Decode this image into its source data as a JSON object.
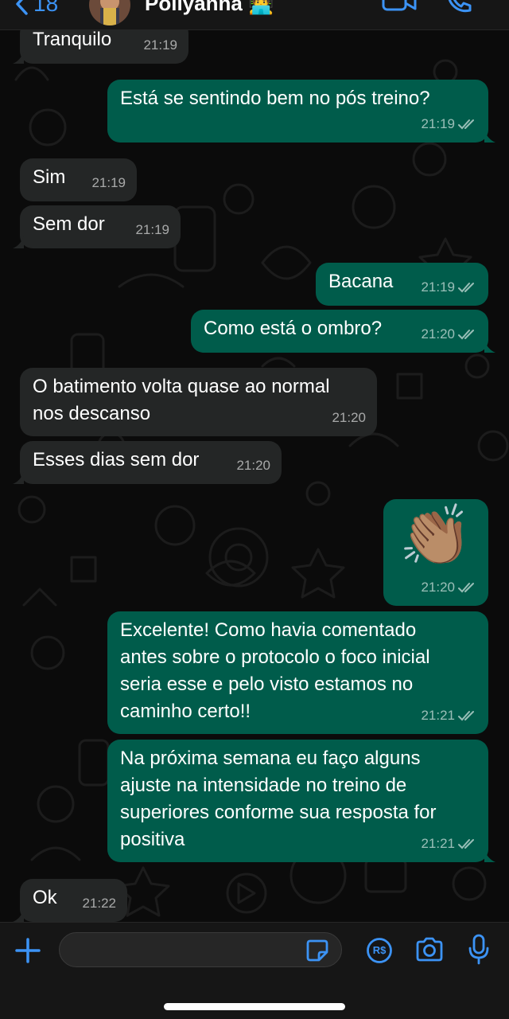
{
  "header": {
    "back_count": "18",
    "contact_name": "Pollyanna",
    "name_emoji": "🧑‍💻"
  },
  "messages": [
    {
      "text": "Tranquilo",
      "time": "21:19"
    },
    {
      "text": "Está se sentindo bem no pós treino?",
      "time": "21:19"
    },
    {
      "text": "Sim",
      "time": "21:19"
    },
    {
      "text": "Sem dor",
      "time": "21:19"
    },
    {
      "text": "Bacana",
      "time": "21:19"
    },
    {
      "text": "Como está o ombro?",
      "time": "21:20"
    },
    {
      "text": "O batimento volta quase ao normal\nnos descanso",
      "time": "21:20"
    },
    {
      "text": "Esses dias sem dor",
      "time": "21:20"
    },
    {
      "text": "👏🏽",
      "time": "21:20"
    },
    {
      "text": "Excelente! Como havia comentado\nantes sobre o protocolo o foco inicial\nseria esse e pelo visto estamos no\ncaminho certo!!",
      "time": "21:21"
    },
    {
      "text": "Na próxima semana eu faço alguns\najuste na intensidade no treino de\nsuperiores conforme sua resposta for\npositiva",
      "time": "21:21"
    },
    {
      "text": "Ok",
      "time": "21:22"
    }
  ],
  "composer": {
    "value": "",
    "pay_label": "R$"
  },
  "colors": {
    "incoming_bubble": "#242626",
    "outgoing_bubble": "#005c4b",
    "accent": "#3c93f5"
  }
}
